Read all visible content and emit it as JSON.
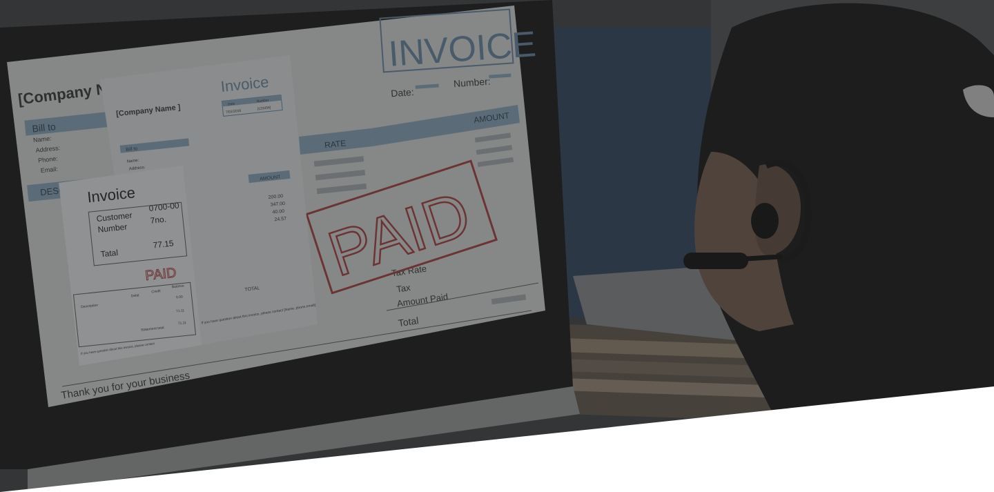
{
  "scene": {
    "description_tags": [
      "monitor-with-invoice",
      "woman-with-headset",
      "stack-of-papers"
    ]
  },
  "screen": {
    "big_invoice": {
      "title": "INVOICE",
      "date_label": "Date:",
      "number_label": "Number:",
      "company_name": "[Company Name ]",
      "bill_to": "Bill to",
      "fields": [
        "Name:",
        "Address:",
        "Phone:",
        "Email:"
      ],
      "description_header": "DESCRIPTION",
      "rate_header": "RATE",
      "amount_header": "AMOUNT",
      "tax_rate": "Tax Rate",
      "tax": "Tax",
      "amount_paid": "Amount Paid",
      "total": "Total",
      "thanks": "Thank  you for your business",
      "stamp": "PAID"
    },
    "middle_invoice": {
      "title": "Invoice",
      "company_name": "[Company Name ]",
      "date_header": "Date",
      "number_header": "Number",
      "date_value": "7/01/2016",
      "number_value": "[123456]",
      "bill_to": "Bill to",
      "fields": [
        "Name:",
        "Address:"
      ],
      "amount_header": "AMOUNT",
      "amounts": [
        "200.00",
        "347.00",
        "40.00",
        "24.57"
      ],
      "total_label": "TOTAL",
      "footer": "If you have question about this invoice, please contact [Name, phone,email]"
    },
    "small_invoice": {
      "title": "Invoice",
      "customer_label": "Customer",
      "customer_value": "0700-00",
      "number_label": "Number",
      "number_value": "7no.",
      "total_label": "Tatal",
      "total_value": "77.15",
      "stamp": "PAID",
      "columns": [
        "Description",
        "Debit",
        "Credit",
        "Balance"
      ],
      "values": [
        "0.00",
        "71.11",
        "71.11"
      ],
      "statement_total": "Statement total",
      "footer": "If you have question about this invoice, please contact"
    }
  },
  "colors": {
    "overlay": "#2a2a2a",
    "screen_paper": "#c9cbcc",
    "accent_blue": "#5f7f98",
    "stamp_red": "#9a3a3a",
    "hair": "#141414",
    "skin": "#6b5548",
    "wall_blue": "#2b4058",
    "monitor_frame": "#151515"
  }
}
